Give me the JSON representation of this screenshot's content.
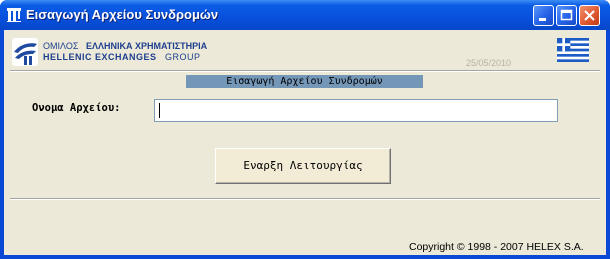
{
  "window": {
    "title": "Εισαγωγή Αρχείου Συνδρομών"
  },
  "header": {
    "logo_line1_prefix": "ΟΜΙΛΟΣ",
    "logo_line1_brand": "ΕΛΛΗΝΙΚΑ ΧΡΗΜΑΤΙΣΤΗΡΙΑ",
    "logo_line2_brand": "HELLENIC EXCHANGES",
    "logo_line2_suffix": "GROUP",
    "date": "25/05/2010"
  },
  "form": {
    "section_title": "Εισαγωγή Αρχείου Συνδρομών",
    "file_label": "Ονομα Αρχείου:",
    "file_value": "",
    "start_button": "Εναρξη Λειτουργίας"
  },
  "footer": {
    "copyright": "Copyright © 1998 - 2007 HELEX S.A."
  },
  "colors": {
    "titlebar": "#0850dc",
    "section_header_bg": "#7497b8",
    "client_bg": "#ece9d8"
  }
}
